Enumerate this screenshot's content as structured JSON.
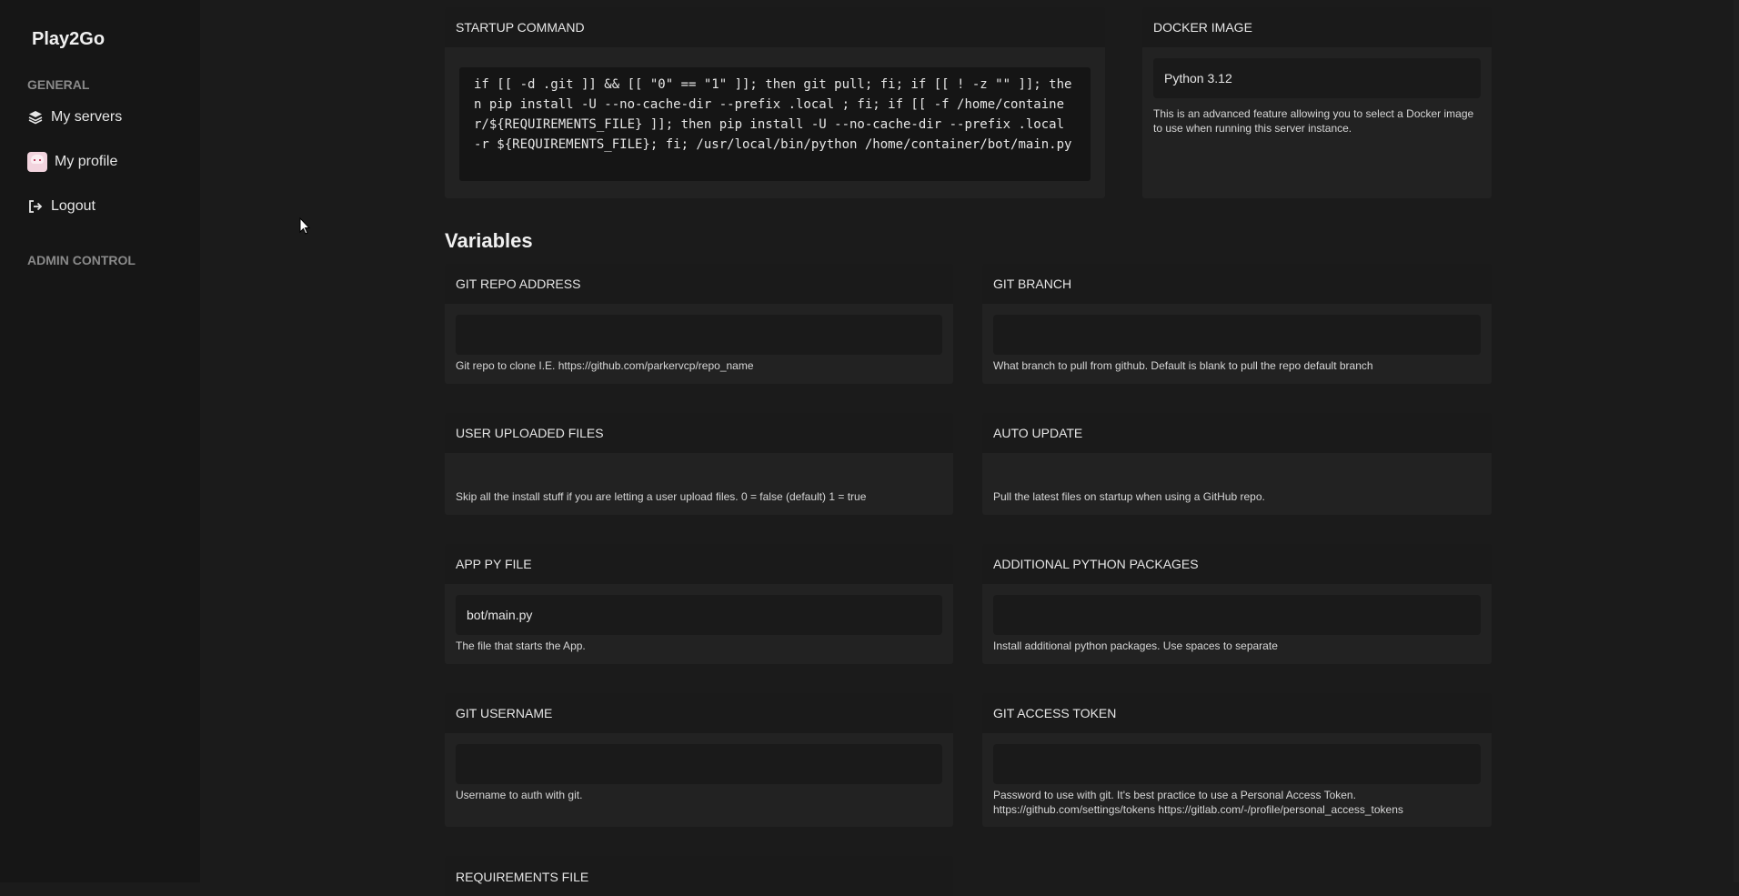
{
  "sidebar": {
    "brand": "Play2Go",
    "general_label": "GENERAL",
    "items": [
      {
        "label": "My servers",
        "icon": "layers-icon"
      },
      {
        "label": "My profile",
        "icon": "avatar"
      },
      {
        "label": "Logout",
        "icon": "logout-icon"
      }
    ],
    "admin_label": "ADMIN CONTROL"
  },
  "startup": {
    "title": "STARTUP COMMAND",
    "command": "if [[ -d .git ]] && [[ \"0\" == \"1\" ]]; then git pull; fi; if [[ ! -z \"\" ]]; then pip install -U --no-cache-dir --prefix .local ; fi; if [[ -f /home/container/${REQUIREMENTS_FILE} ]]; then pip install -U --no-cache-dir --prefix .local -r ${REQUIREMENTS_FILE}; fi; /usr/local/bin/python /home/container/bot/main.py"
  },
  "docker": {
    "title": "DOCKER IMAGE",
    "value": "Python 3.12",
    "help": "This is an advanced feature allowing you to select a Docker image to use when running this server instance."
  },
  "variables_title": "Variables",
  "variables": {
    "git_repo": {
      "title": "GIT REPO ADDRESS",
      "value": "",
      "help": "Git repo to clone I.E. https://github.com/parkervcp/repo_name"
    },
    "git_branch": {
      "title": "GIT BRANCH",
      "value": "",
      "help": "What branch to pull from github. Default is blank to pull the repo default branch"
    },
    "user_uploaded": {
      "title": "USER UPLOADED FILES",
      "help": "Skip all the install stuff if you are letting a user upload files. 0 = false (default) 1 = true"
    },
    "auto_update": {
      "title": "AUTO UPDATE",
      "help": "Pull the latest files on startup when using a GitHub repo."
    },
    "app_py": {
      "title": "APP PY FILE",
      "value": "bot/main.py",
      "help": "The file that starts the App."
    },
    "py_packages": {
      "title": "ADDITIONAL PYTHON PACKAGES",
      "value": "",
      "help": "Install additional python packages. Use spaces to separate"
    },
    "git_username": {
      "title": "GIT USERNAME",
      "value": "",
      "help": "Username to auth with git."
    },
    "git_token": {
      "title": "GIT ACCESS TOKEN",
      "value": "",
      "help": "Password to use with git. It's best practice to use a Personal Access Token. https://github.com/settings/tokens https://gitlab.com/-/profile/personal_access_tokens"
    },
    "requirements": {
      "title": "REQUIREMENTS FILE"
    }
  }
}
